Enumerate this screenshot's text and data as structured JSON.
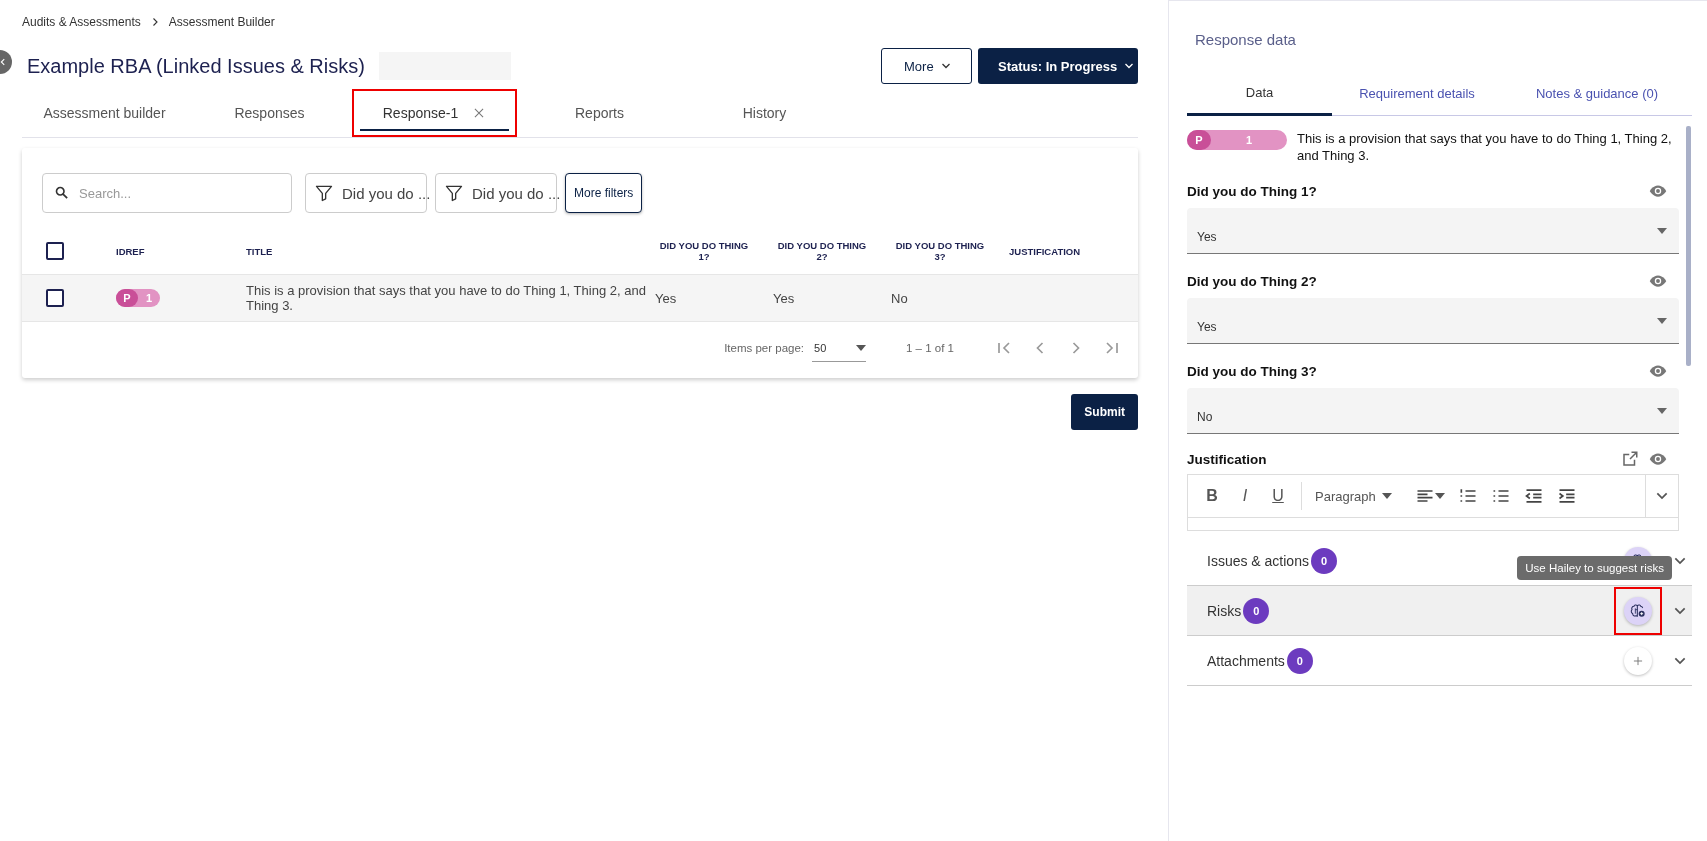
{
  "breadcrumb": [
    "Audits & Assessments",
    "Assessment Builder"
  ],
  "title": "Example RBA (Linked Issues & Risks)",
  "header_buttons": {
    "more": "More",
    "status": "Status: In Progress"
  },
  "tabs": [
    {
      "label": "Assessment builder",
      "selected": false,
      "closable": false,
      "highlighted": false
    },
    {
      "label": "Responses",
      "selected": false,
      "closable": false,
      "highlighted": false
    },
    {
      "label": "Response-1",
      "selected": true,
      "closable": true,
      "highlighted": true
    },
    {
      "label": "Reports",
      "selected": false,
      "closable": false,
      "highlighted": false
    },
    {
      "label": "History",
      "selected": false,
      "closable": false,
      "highlighted": false
    }
  ],
  "search": {
    "placeholder": "Search..."
  },
  "filters": [
    "Did you do ...",
    "Did you do ..."
  ],
  "more_filters": "More filters",
  "table": {
    "select_all_checked": false,
    "columns": [
      "IDREF",
      "TITLE",
      "DID YOU DO THING 1?",
      "DID YOU DO THING 2?",
      "DID YOU DO THING 3?",
      "JUSTIFICATION"
    ],
    "rows": [
      {
        "checked": false,
        "badge": {
          "letter": "P",
          "number": "1"
        },
        "title": "This is a provision that says that you have to do Thing 1, Thing 2, and Thing 3.",
        "answers": [
          "Yes",
          "Yes",
          "No"
        ]
      }
    ]
  },
  "pagination": {
    "label": "Items per page:",
    "page_size": "50",
    "range": "1 – 1 of 1"
  },
  "submit": "Submit",
  "panel": {
    "title": "Response data",
    "tabs": [
      {
        "label": "Data",
        "selected": true
      },
      {
        "label": "Requirement details",
        "selected": false
      },
      {
        "label": "Notes & guidance (0)",
        "selected": false
      }
    ],
    "provision": {
      "letter": "P",
      "number": "1",
      "text": "This is a provision that says that you have to do Thing 1, Thing 2, and Thing 3."
    },
    "questions": [
      {
        "label": "Did you do Thing 1?",
        "value": "Yes"
      },
      {
        "label": "Did you do Thing 2?",
        "value": "Yes"
      },
      {
        "label": "Did you do Thing 3?",
        "value": "No"
      }
    ],
    "justification": {
      "label": "Justification",
      "format_buttons": [
        "B",
        "I",
        "U"
      ],
      "block_format": "Paragraph"
    },
    "sections": [
      {
        "label": "Issues & actions",
        "count": "0",
        "kind": "hailey",
        "hovered": false,
        "highlighted": false
      },
      {
        "label": "Risks",
        "count": "0",
        "kind": "hailey",
        "hovered": true,
        "highlighted": true
      },
      {
        "label": "Attachments",
        "count": "0",
        "kind": "add",
        "hovered": false,
        "highlighted": false
      }
    ],
    "tooltip": "Use Hailey to suggest risks"
  }
}
